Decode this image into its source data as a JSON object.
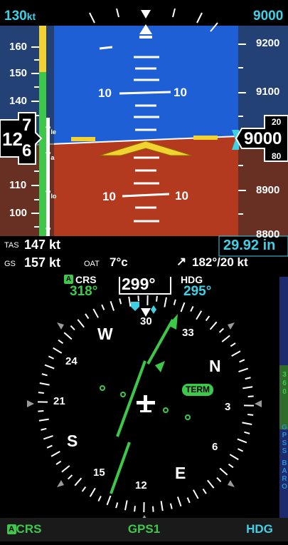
{
  "top": {
    "airspeed_bug": "130",
    "airspeed_bug_unit": "kt",
    "altitude_bug": "9000"
  },
  "airspeed_tape": {
    "labels": [
      "160",
      "150",
      "140",
      "120",
      "110",
      "100"
    ],
    "vspeeds": [
      "V",
      "le",
      "V",
      "a",
      "V",
      "lo",
      "V"
    ],
    "current_hundreds": "12",
    "current_units_upper": "7",
    "current_units_lower": "6"
  },
  "altitude_tape": {
    "labels": [
      "9200",
      "9100",
      "8900",
      "8800"
    ],
    "current": "9000",
    "roller_upper": "20",
    "roller_lower": "80"
  },
  "attitude": {
    "pitch_labels": [
      "10",
      "10",
      "10",
      "10"
    ]
  },
  "data_bar": {
    "tas_label": "TAS",
    "tas_value": "147 kt",
    "gs_label": "GS",
    "gs_value": "157 kt",
    "oat_label": "OAT",
    "oat_value": "7°c",
    "wind": "182°/20 kt",
    "baro": "29.92 in"
  },
  "hsi": {
    "crs_badge": "A",
    "crs_label": "CRS",
    "crs_value": "318°",
    "heading": "299°",
    "hdg_label": "HDG",
    "hdg_value": "295°",
    "cardinal": {
      "n": "N",
      "e": "E",
      "s": "S",
      "w": "W",
      "n30": "30",
      "n33": "33",
      "n3": "3",
      "n6": "6",
      "n12": "12",
      "n15": "15",
      "n21": "21",
      "n24": "24"
    },
    "term": "TERM",
    "side_scale": [
      "3",
      "6",
      "0"
    ],
    "side_labels": [
      "G",
      "P",
      "S",
      "S",
      "B",
      "A",
      "R",
      "O"
    ]
  },
  "bottom": {
    "acrs_badge": "A",
    "acrs_label": "CRS",
    "gps": "GPS1",
    "hdg": "HDG"
  },
  "colors": {
    "sky": "#1f5fd6",
    "ground": "#b33a1e",
    "tape_bg": "#3a3a3a",
    "cyan": "#3fd0e6",
    "green": "#3ec84a",
    "yellow": "#f2d230"
  }
}
